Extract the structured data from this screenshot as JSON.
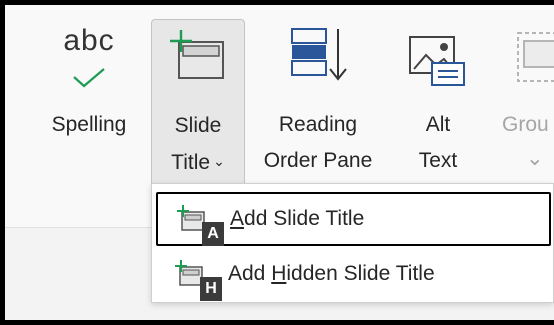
{
  "ribbon": {
    "spelling": {
      "icon_text": "abc",
      "label": "Spelling",
      "icon": "checkmark-icon"
    },
    "slide_title": {
      "line1": "Slide",
      "line2": "Title",
      "chevron": "⌄",
      "icon": "slide-title-icon"
    },
    "reading_order": {
      "line1": "Reading",
      "line2": "Order Pane",
      "icon": "reading-order-icon"
    },
    "alt_text": {
      "line1": "Alt",
      "line2": "Text",
      "icon": "alt-text-icon"
    },
    "group": {
      "line1": "Grou",
      "chevron": "⌄",
      "icon": "group-icon"
    }
  },
  "menu": {
    "items": [
      {
        "pre": "",
        "accel": "A",
        "post": "dd Slide Title",
        "keytip": "A",
        "icon": "add-slide-title-icon"
      },
      {
        "pre": "Add ",
        "accel": "H",
        "post": "idden Slide Title",
        "keytip": "H",
        "icon": "add-hidden-slide-title-icon"
      }
    ]
  },
  "colors": {
    "accent_green": "#1e9c54",
    "accent_blue": "#2b579a",
    "keytip_bg": "#3b3b3b"
  }
}
